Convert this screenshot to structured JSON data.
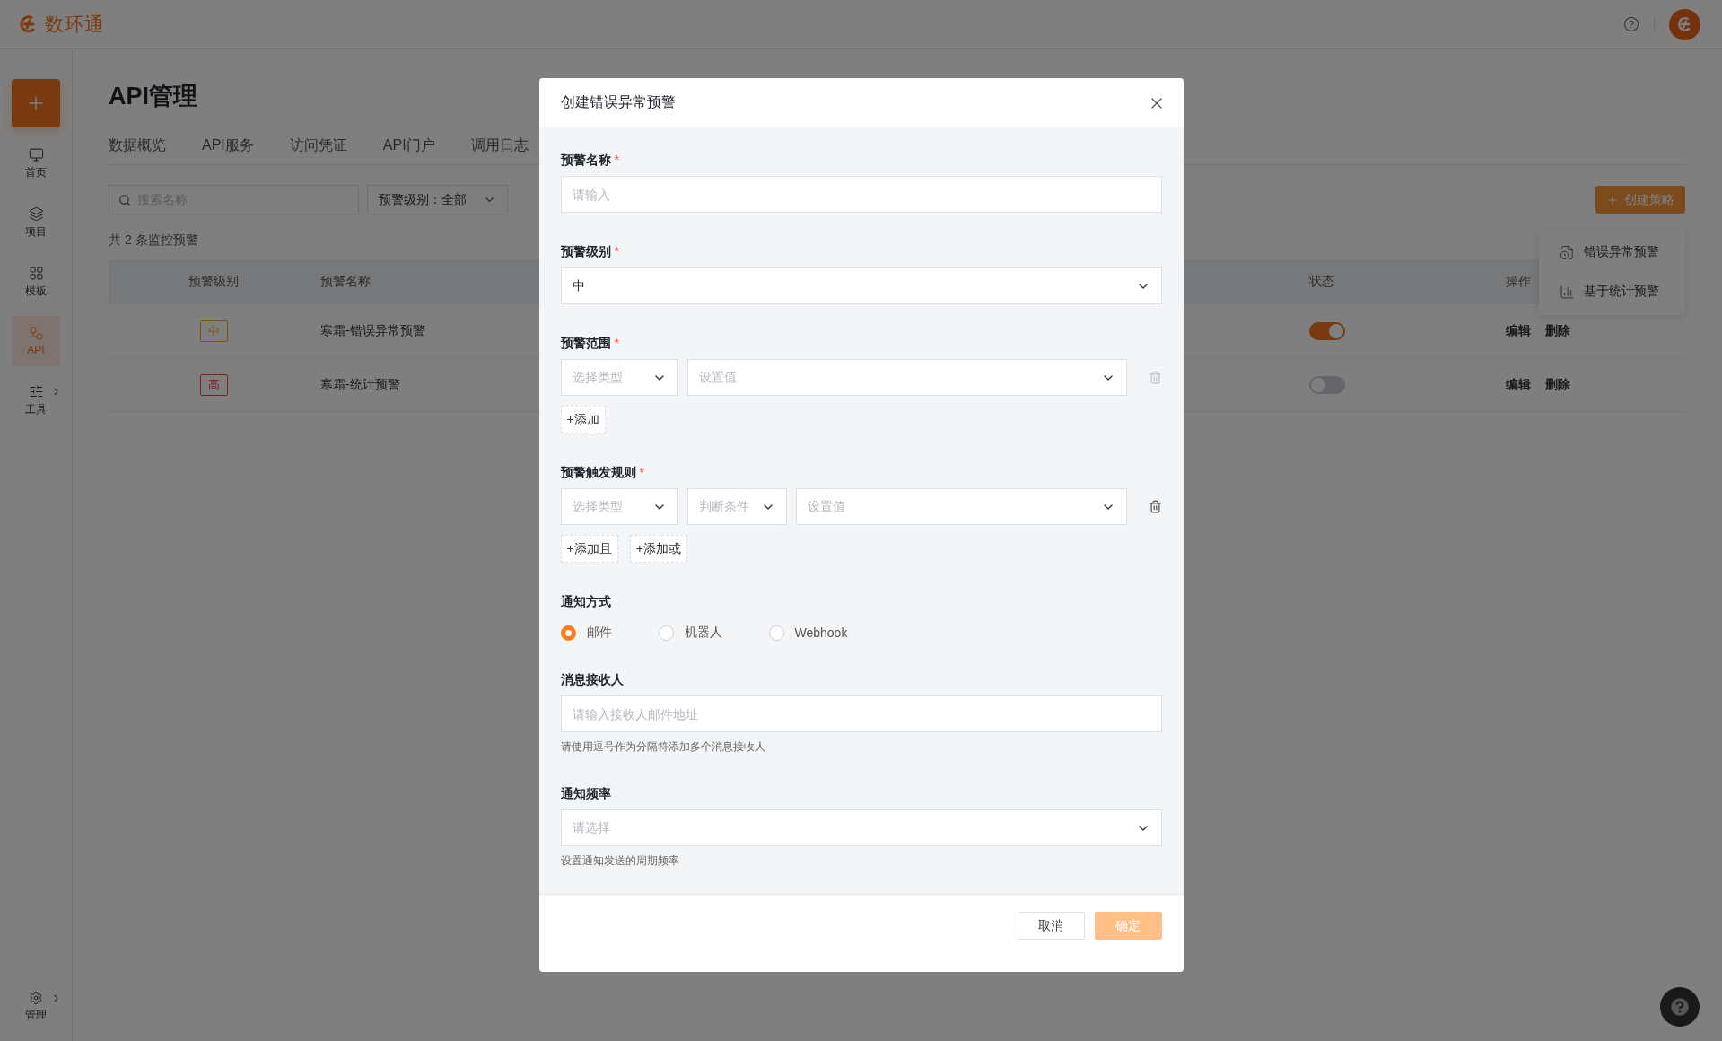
{
  "header": {
    "logo_text": "数环通"
  },
  "sidebar": {
    "items": [
      {
        "label": "首页",
        "selected": false,
        "submenu": false
      },
      {
        "label": "项目",
        "selected": false,
        "submenu": false
      },
      {
        "label": "模板",
        "selected": false,
        "submenu": false
      },
      {
        "label": "API",
        "selected": true,
        "submenu": false
      },
      {
        "label": "工具",
        "selected": false,
        "submenu": true
      }
    ],
    "bottom_item": {
      "label": "管理",
      "submenu": true
    }
  },
  "page": {
    "title": "API管理",
    "tabs": [
      {
        "label": "数据概览"
      },
      {
        "label": "API服务"
      },
      {
        "label": "访问凭证"
      },
      {
        "label": "API门户"
      },
      {
        "label": "调用日志"
      }
    ],
    "search": {
      "placeholder": "搜索名称"
    },
    "filters": [
      {
        "label": "预警级别：全部"
      }
    ],
    "create_button": "创建策略",
    "create_menu": [
      {
        "label": "错误异常预警"
      },
      {
        "label": "基于统计预警"
      }
    ],
    "count": "共 2 条监控预警",
    "table": {
      "columns": [
        "预警级别",
        "预警名称",
        "状态",
        "操作"
      ],
      "rows": [
        {
          "level": "中",
          "kind": "medium",
          "name": "寒霜-错误异常预警",
          "on": true,
          "actions": [
            "编辑",
            "删除"
          ]
        },
        {
          "level": "高",
          "kind": "high",
          "name": "寒霜-统计预警",
          "on": false,
          "actions": [
            "编辑",
            "删除"
          ]
        }
      ]
    }
  },
  "modal": {
    "title": "创建错误异常预警",
    "fields": [
      {
        "kind": "input",
        "label": "预警名称",
        "required_mark": "*",
        "placeholder": "请输入"
      },
      {
        "kind": "select",
        "label": "预警级别",
        "required_mark": "*",
        "value": "中"
      },
      {
        "kind": "rule",
        "label": "预警范围",
        "required_mark": "*",
        "controls": [
          {
            "placeholder": "选择类型"
          },
          {
            "placeholder": "设置值"
          }
        ],
        "delete_disabled": true,
        "actions": [
          "+添加"
        ]
      },
      {
        "kind": "rule",
        "label": "预警触发规则",
        "required_mark": "*",
        "controls": [
          {
            "placeholder": "选择类型"
          },
          {
            "placeholder": "判断条件"
          },
          {
            "placeholder": "设置值"
          }
        ],
        "delete_disabled": false,
        "actions": [
          "+添加且",
          "+添加或"
        ]
      },
      {
        "kind": "radio",
        "label": "通知方式",
        "options": [
          {
            "label": "邮件",
            "selected": true
          },
          {
            "label": "机器人",
            "selected": false
          },
          {
            "label": "Webhook",
            "selected": false
          }
        ]
      },
      {
        "kind": "input",
        "label": "消息接收人",
        "placeholder": "请输入接收人邮件地址",
        "help": "请使用逗号作为分隔符添加多个消息接收人"
      },
      {
        "kind": "select",
        "label": "通知频率",
        "placeholder": "请选择",
        "help": "设置通知发送的周期频率"
      }
    ],
    "buttons": [
      {
        "label": "取消",
        "kind": "secondary"
      },
      {
        "label": "确定",
        "kind": "primary",
        "disabled": true
      }
    ]
  }
}
